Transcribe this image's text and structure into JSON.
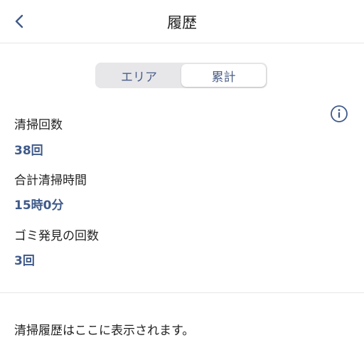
{
  "header": {
    "title": "履歴",
    "back_icon": "chevron-left-icon"
  },
  "segment": {
    "items": [
      {
        "label": "エリア",
        "selected": false
      },
      {
        "label": "累計",
        "selected": true
      }
    ]
  },
  "info_icon": "info-circle-icon",
  "stats": [
    {
      "label": "清掃回数",
      "value": "38回"
    },
    {
      "label": "合計清掃時間",
      "value": "15時0分"
    },
    {
      "label": "ゴミ発見の回数",
      "value": "3回"
    }
  ],
  "history": {
    "empty_message": "清掃履歴はここに表示されます。"
  },
  "colors": {
    "accent": "#3f5a8a",
    "segment_bg": "#e7e7ea"
  }
}
